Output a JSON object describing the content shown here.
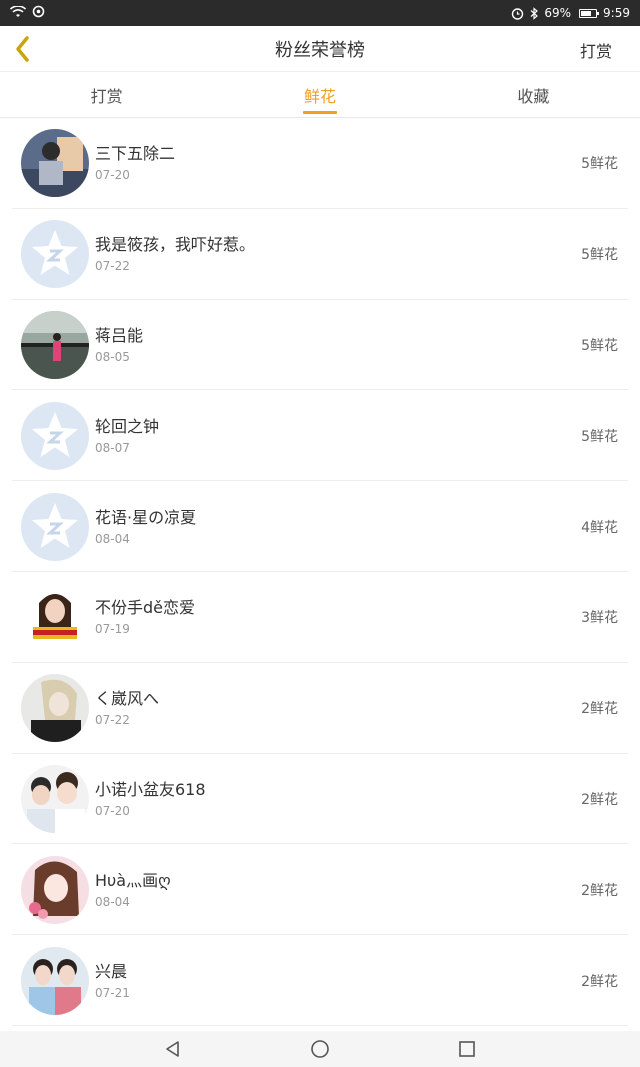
{
  "status_bar": {
    "battery": "69%",
    "time": "9:59",
    "battery_level": 0.69
  },
  "header": {
    "title": "粉丝荣誉榜",
    "action_label": "打赏"
  },
  "tabs": [
    {
      "label": "打赏",
      "active": false
    },
    {
      "label": "鲜花",
      "active": true
    },
    {
      "label": "收藏",
      "active": false
    }
  ],
  "rows": [
    {
      "name": "三下五除二",
      "date": "07-20",
      "count": "5鲜花",
      "avatar": "photo-person-avatar"
    },
    {
      "name": "我是筱孩，我吓好惹。",
      "date": "07-22",
      "count": "5鲜花",
      "avatar": "default-star-avatar"
    },
    {
      "name": "蒋吕能",
      "date": "08-05",
      "count": "5鲜花",
      "avatar": "photo-outdoor-avatar"
    },
    {
      "name": "轮回之钟",
      "date": "08-07",
      "count": "5鲜花",
      "avatar": "default-star-avatar"
    },
    {
      "name": "花语·星の凉夏",
      "date": "08-04",
      "count": "4鲜花",
      "avatar": "default-star-avatar"
    },
    {
      "name": "不份手dě恋爱",
      "date": "07-19",
      "count": "3鲜花",
      "avatar": "photo-girl-avatar"
    },
    {
      "name": "く崴风へ",
      "date": "07-22",
      "count": "2鲜花",
      "avatar": "photo-anime-avatar"
    },
    {
      "name": "小诺小盆友618",
      "date": "07-20",
      "count": "2鲜花",
      "avatar": "photo-couple-avatar"
    },
    {
      "name": "Hυà灬画ღ",
      "date": "08-04",
      "count": "2鲜花",
      "avatar": "photo-flower-girl-avatar"
    },
    {
      "name": "兴晨",
      "date": "07-21",
      "count": "2鲜花",
      "avatar": "photo-two-girls-avatar"
    }
  ],
  "colors": {
    "accent": "#f0a020",
    "back_icon": "#c9a40a",
    "default_avatar_bg": "#dde7f4"
  }
}
